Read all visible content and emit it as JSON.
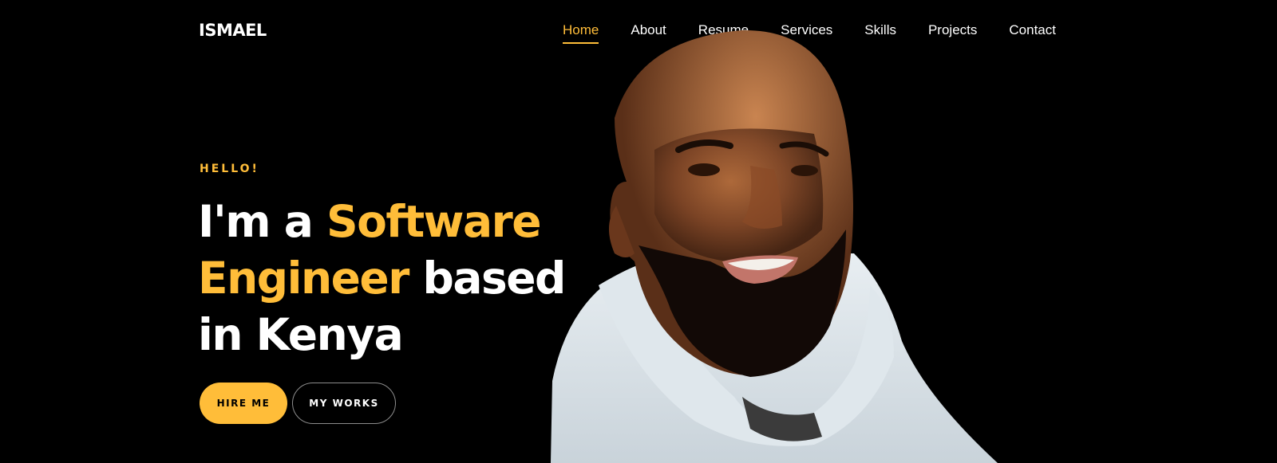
{
  "header": {
    "logo": "ISMAEL",
    "nav": [
      {
        "label": "Home",
        "active": true
      },
      {
        "label": "About",
        "active": false
      },
      {
        "label": "Resume",
        "active": false
      },
      {
        "label": "Services",
        "active": false
      },
      {
        "label": "Skills",
        "active": false
      },
      {
        "label": "Projects",
        "active": false
      },
      {
        "label": "Contact",
        "active": false
      }
    ]
  },
  "hero": {
    "subheading": "HELLO!",
    "headline": {
      "part1": "I'm a ",
      "accent1": "Software",
      "accent2": "Engineer",
      "part2": " based",
      "part3": "in Kenya"
    },
    "buttons": {
      "primary": "HIRE ME",
      "secondary": "MY WORKS"
    },
    "photo": "portrait-photo"
  },
  "colors": {
    "background": "#000000",
    "accent": "#ffbd39",
    "text": "#ffffff"
  }
}
